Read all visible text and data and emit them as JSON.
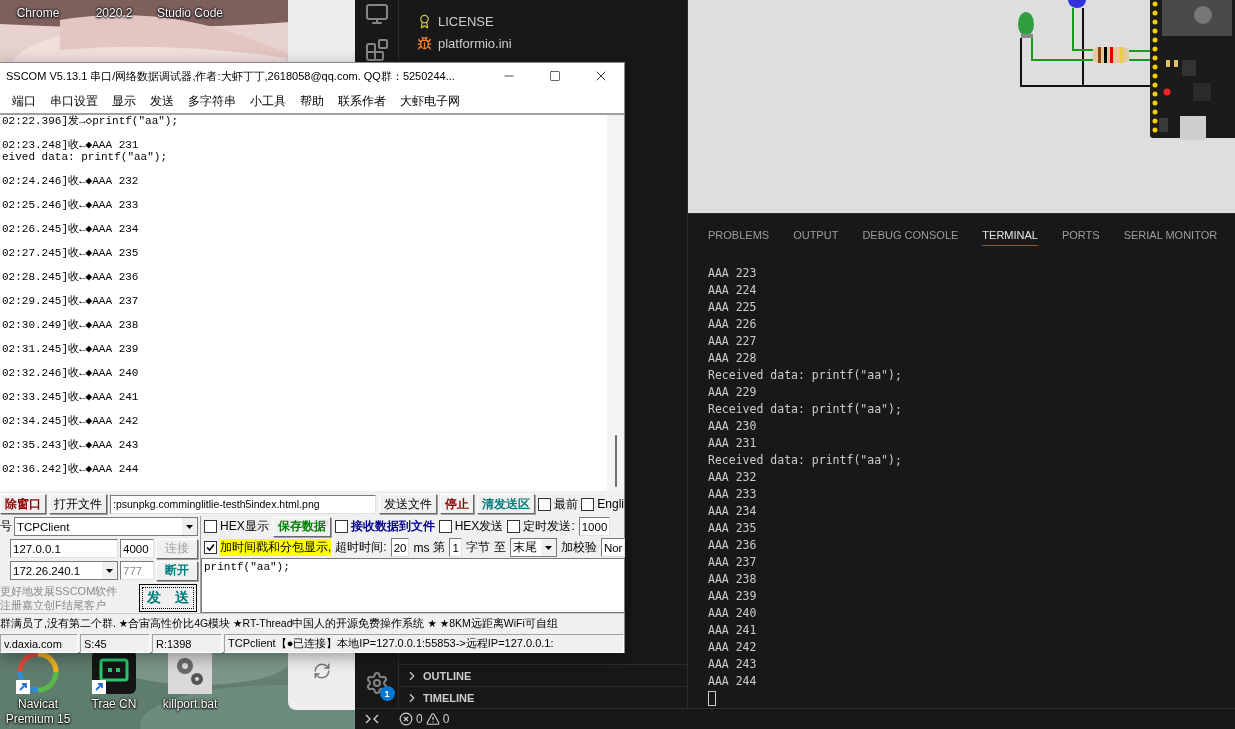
{
  "desktop": {
    "top_labels": [
      "Chrome",
      "2020.2",
      "Studio Code"
    ],
    "icons": [
      {
        "label": "Navicat Premium 15",
        "kind": "swirl",
        "shortcut": true
      },
      {
        "label": "Trae CN",
        "kind": "terminal",
        "shortcut": true
      },
      {
        "label": "killport.bat",
        "kind": "gears",
        "shortcut": false
      }
    ]
  },
  "vscode": {
    "explorer": [
      {
        "label": "LICENSE",
        "kind": "license"
      },
      {
        "label": "platformio.ini",
        "kind": "platformio"
      }
    ],
    "sections": [
      {
        "label": "OUTLINE",
        "expanded": false
      },
      {
        "label": "TIMELINE",
        "expanded": false
      }
    ],
    "settings_badge": "1",
    "panel_tabs": [
      {
        "label": "PROBLEMS",
        "selected": false
      },
      {
        "label": "OUTPUT",
        "selected": false
      },
      {
        "label": "DEBUG CONSOLE",
        "selected": false
      },
      {
        "label": "TERMINAL",
        "selected": true
      },
      {
        "label": "PORTS",
        "selected": false
      },
      {
        "label": "SERIAL MONITOR",
        "selected": false
      }
    ],
    "terminal_lines": [
      "AAA 223",
      "AAA 224",
      "AAA 225",
      "AAA 226",
      "AAA 227",
      "AAA 228",
      "Received data: printf(\"aa\");",
      "AAA 229",
      "Received data: printf(\"aa\");",
      "AAA 230",
      "AAA 231",
      "Received data: printf(\"aa\");",
      "AAA 232",
      "AAA 233",
      "AAA 234",
      "AAA 235",
      "AAA 236",
      "AAA 237",
      "AAA 238",
      "AAA 239",
      "AAA 240",
      "AAA 241",
      "AAA 242",
      "AAA 243",
      "AAA 244"
    ],
    "status": {
      "errors": "0",
      "warnings": "0"
    }
  },
  "sscom": {
    "title": "SSCOM V5.13.1 串口/网络数据调试器,作者:大虾丁丁,2618058@qq.com. QQ群：5250244...",
    "menu": [
      "端口",
      "串口设置",
      "显示",
      "发送",
      "多字符串",
      "小工具",
      "帮助",
      "联系作者",
      "大虾电子网"
    ],
    "log": [
      {
        "lines": [
          "02:22.396]发→◇printf(\"aa\");"
        ]
      },
      {
        "lines": [
          "02:23.248]收←◆AAA 231",
          "eived data: printf(\"aa\");"
        ]
      },
      {
        "lines": [
          "02:24.246]收←◆AAA 232"
        ]
      },
      {
        "lines": [
          "02:25.246]收←◆AAA 233"
        ]
      },
      {
        "lines": [
          "02:26.245]收←◆AAA 234"
        ]
      },
      {
        "lines": [
          "02:27.245]收←◆AAA 235"
        ]
      },
      {
        "lines": [
          "02:28.245]收←◆AAA 236"
        ]
      },
      {
        "lines": [
          "02:29.245]收←◆AAA 237"
        ]
      },
      {
        "lines": [
          "02:30.249]收←◆AAA 238"
        ]
      },
      {
        "lines": [
          "02:31.245]收←◆AAA 239"
        ]
      },
      {
        "lines": [
          "02:32.246]收←◆AAA 240"
        ]
      },
      {
        "lines": [
          "02:33.245]收←◆AAA 241"
        ]
      },
      {
        "lines": [
          "02:34.245]收←◆AAA 242"
        ]
      },
      {
        "lines": [
          "02:35.243]收←◆AAA 243"
        ]
      },
      {
        "lines": [
          "02:36.242]收←◆AAA 244"
        ]
      }
    ],
    "toolbar": [
      {
        "kind": "button",
        "label": "除窗口",
        "color": "#8b0000"
      },
      {
        "kind": "button",
        "label": "打开文件"
      },
      {
        "kind": "field",
        "value": ":psunpkg.comminglitlie-testh5index.html.png"
      },
      {
        "kind": "button",
        "label": "发送文件"
      },
      {
        "kind": "button",
        "label": "停止",
        "color": "#8b0000"
      },
      {
        "kind": "button",
        "label": "清发送区",
        "color": "#007b7b"
      },
      {
        "kind": "checkbox",
        "label": "最前",
        "checked": false
      },
      {
        "kind": "checkbox",
        "label": "Engli",
        "checked": false
      }
    ],
    "connection": {
      "mode_label": "号",
      "mode": "TCPClient",
      "remote": {
        "ip": "127.0.0.1",
        "port": "4000",
        "button": {
          "label": "连接",
          "disabled": true
        }
      },
      "local": {
        "ip": "172.26.240.1",
        "port": "777",
        "port_disabled": true,
        "button": {
          "label": "断开",
          "disabled": false,
          "color": "#007b7b"
        }
      },
      "promo": [
        "更好地发展SSCOM软件",
        "注册嘉立创F结尾客户"
      ],
      "send_button": {
        "label": "发　送",
        "color": "#007b7b"
      }
    },
    "options": [
      [
        {
          "kind": "checkbox",
          "label": "HEX显示",
          "checked": false
        },
        {
          "kind": "button",
          "label": "保存数据",
          "color": "#008000"
        },
        {
          "kind": "checkbox",
          "label": "接收数据到文件",
          "checked": false,
          "color": "#00008b"
        },
        {
          "kind": "checkbox",
          "label": "HEX发送",
          "checked": false
        },
        {
          "kind": "checkbox",
          "label": "定时发送:",
          "checked": false
        },
        {
          "kind": "field",
          "value": "1000"
        }
      ],
      [
        {
          "kind": "checkbox",
          "label": "加时间戳和分包显示,",
          "checked": true,
          "highlighted": true
        },
        {
          "kind": "text",
          "label": "超时时间:"
        },
        {
          "kind": "field",
          "value": "20"
        },
        {
          "kind": "text",
          "label": "ms"
        },
        {
          "kind": "text",
          "label": "第"
        },
        {
          "kind": "field",
          "value": "1"
        },
        {
          "kind": "text",
          "label": "字节"
        },
        {
          "kind": "text",
          "label": "至"
        },
        {
          "kind": "select",
          "value": "末尾"
        },
        {
          "kind": "text",
          "label": "加校验"
        },
        {
          "kind": "field",
          "value": "Nor"
        }
      ]
    ],
    "send_text": "printf(\"aa\");",
    "marquee": "群满员了,没有第二个群. ★合宙高性价比4G模块 ★RT-Thread中国人的开源免费操作系统 ★ ★8KM远距离WiFi可自组",
    "status": [
      "v.daxia.com",
      "S:45",
      "R:1398",
      "TCPclient【●已连接】本地IP=127.0.0.1:55853->远程IP=127.0.0.1:"
    ]
  }
}
